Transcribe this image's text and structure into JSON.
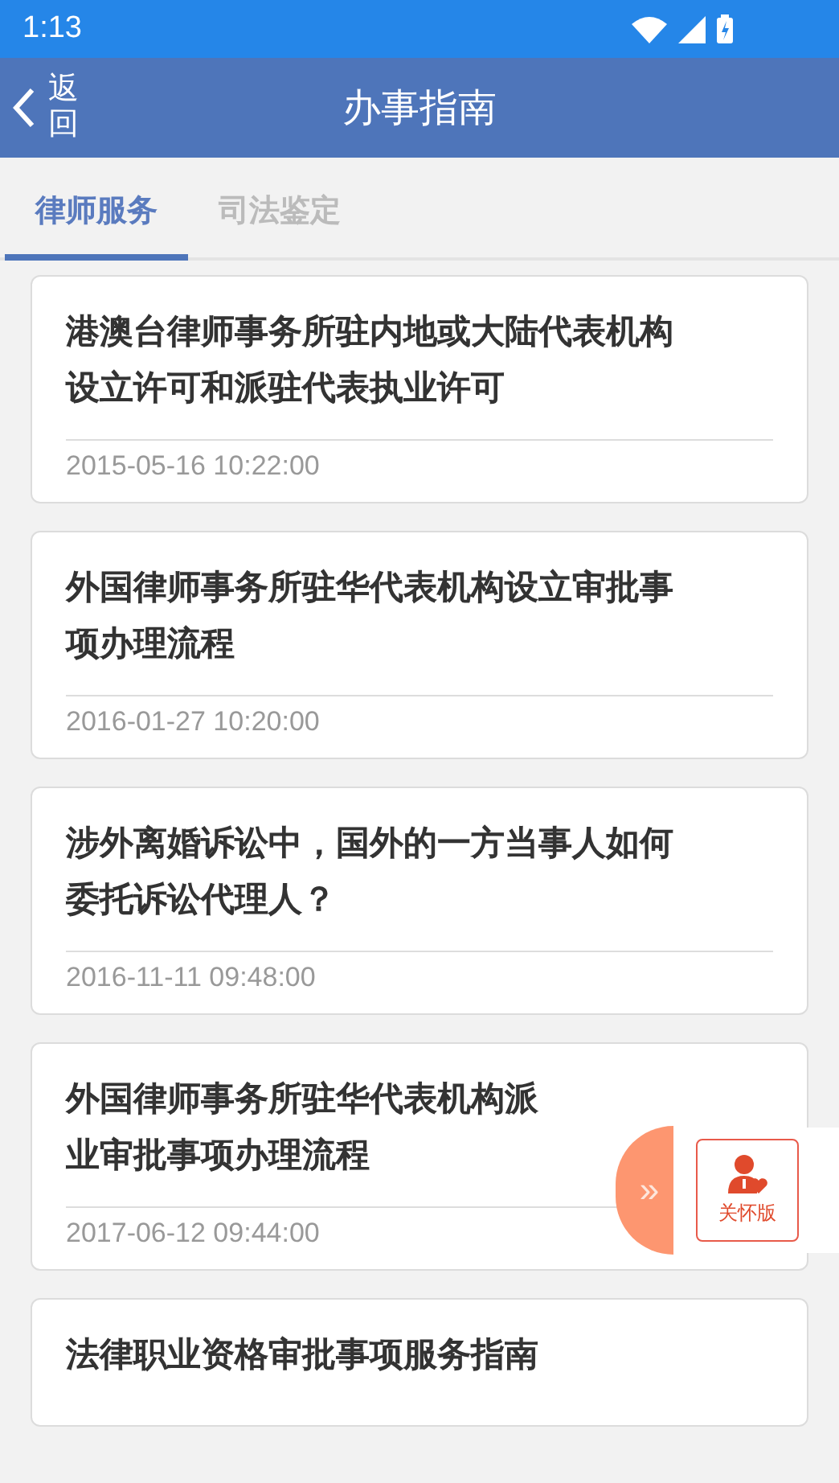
{
  "status_bar": {
    "time": "1:13"
  },
  "header": {
    "back_label": "返回",
    "title": "办事指南"
  },
  "tabs": [
    {
      "label": "律师服务",
      "selected": true
    },
    {
      "label": "司法鉴定",
      "selected": false
    }
  ],
  "items": [
    {
      "title_lines": [
        "港澳台律师事务所驻内地或大陆代表机构",
        "设立许可和派驻代表执业许可"
      ],
      "date": "2015-05-16 10:22:00"
    },
    {
      "title_lines": [
        "外国律师事务所驻华代表机构设立审批事",
        "项办理流程"
      ],
      "date": "2016-01-27 10:20:00"
    },
    {
      "title_lines": [
        "涉外离婚诉讼中，国外的一方当事人如何",
        "委托诉讼代理人？"
      ],
      "date": "2016-11-11 09:48:00"
    },
    {
      "title_lines": [
        "外国律师事务所驻华代表机构派",
        "业审批事项办理流程"
      ],
      "date": "2017-06-12 09:44:00"
    },
    {
      "title_lines": [
        "法律职业资格审批事项服务指南"
      ]
    }
  ],
  "floating": {
    "expand_glyph": "»",
    "care_label": "关怀版"
  }
}
